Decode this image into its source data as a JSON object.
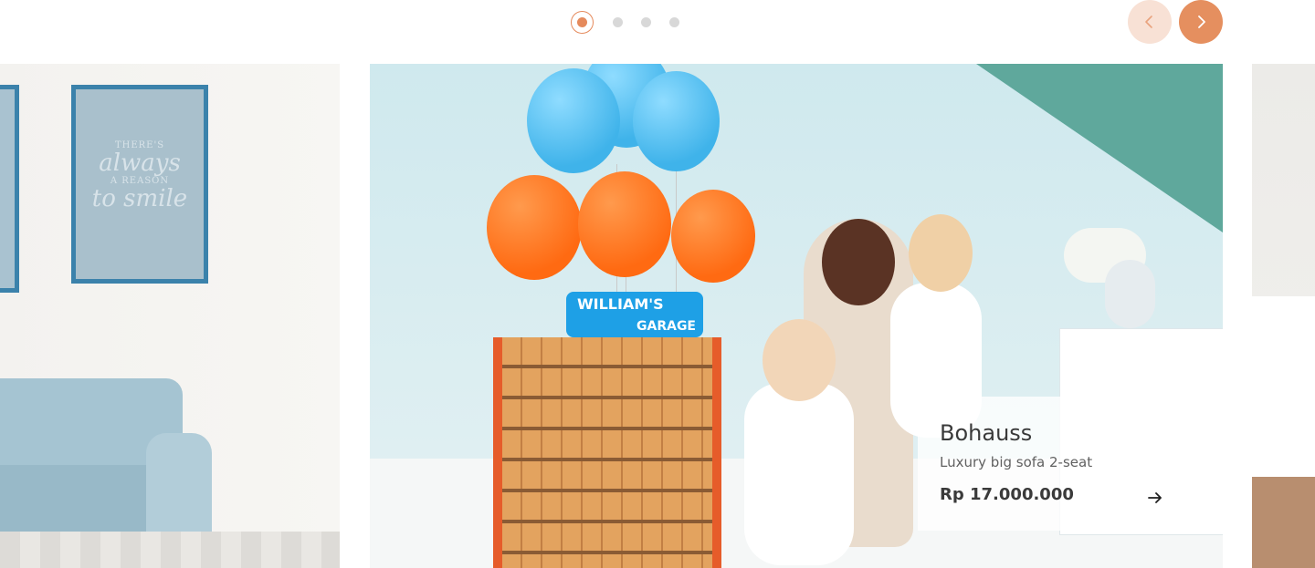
{
  "carousel": {
    "pages": 4,
    "active_page": 1,
    "prev_icon": "chevron-left-icon",
    "next_icon": "chevron-right-icon"
  },
  "left_slide": {
    "quote_line_1": "THERE'S",
    "quote_line_2": "always",
    "quote_line_3": "A REASON",
    "quote_line_4": "to smile"
  },
  "center_slide": {
    "sign_line_1": "WILLIAM'S",
    "sign_line_2": "GARAGE"
  },
  "card": {
    "title": "Bohauss",
    "subtitle": "Luxury big sofa 2-seat",
    "price": "Rp 17.000.000",
    "arrow_icon": "arrow-right-icon"
  },
  "colors": {
    "accent": "#e58f5f",
    "accent_light": "#f8e1d5",
    "inactive_dot": "#d8d8d8"
  }
}
